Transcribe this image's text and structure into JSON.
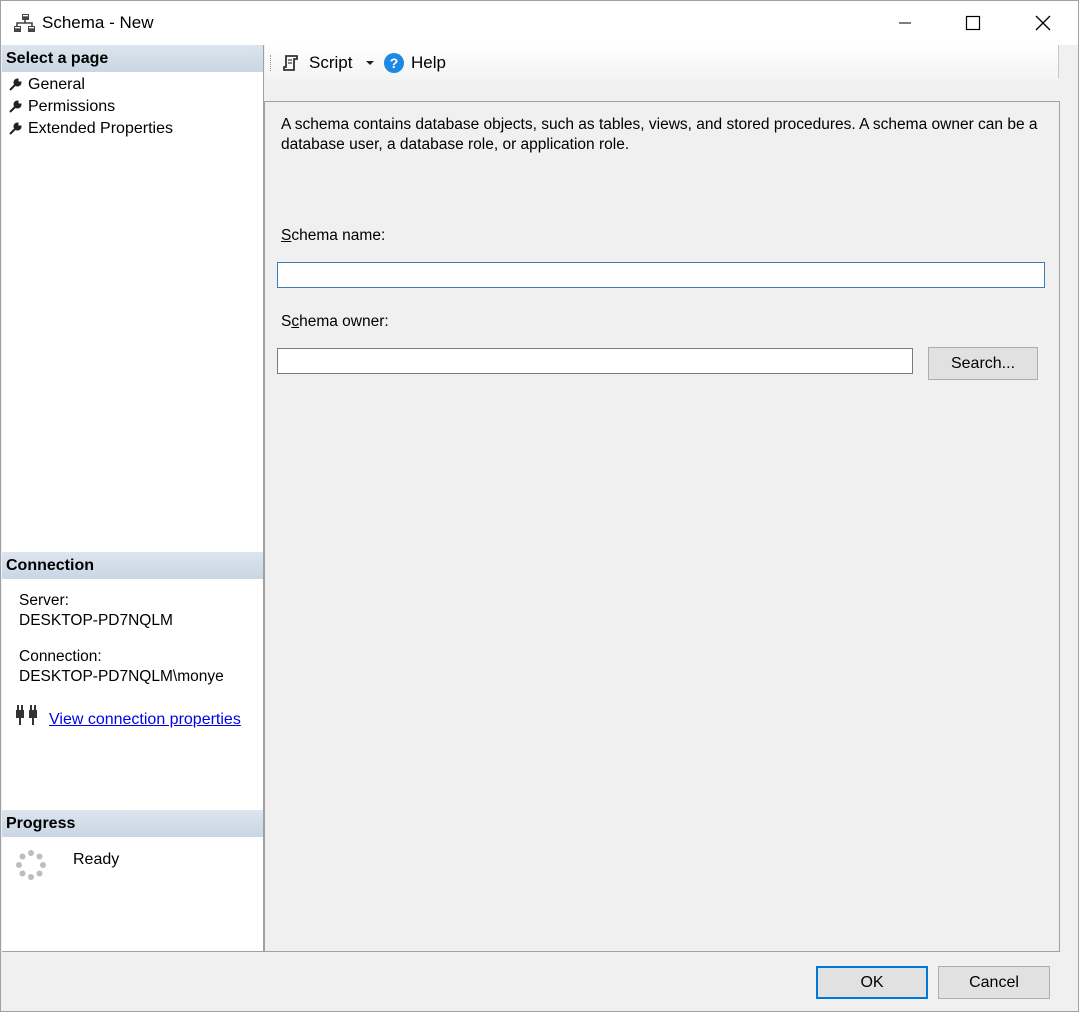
{
  "window": {
    "title": "Schema - New"
  },
  "left_panel": {
    "select_page_header": "Select a page",
    "pages": [
      {
        "label": "General",
        "selected": true
      },
      {
        "label": "Permissions",
        "selected": false
      },
      {
        "label": "Extended Properties",
        "selected": false
      }
    ],
    "connection_header": "Connection",
    "server_label": "Server:",
    "server_value": "DESKTOP-PD7NQLM",
    "connection_label": "Connection:",
    "connection_value": "DESKTOP-PD7NQLM\\monye",
    "view_connection_link": "View connection properties",
    "progress_header": "Progress",
    "progress_status": "Ready"
  },
  "toolbar": {
    "script_label": "Script",
    "help_label": "Help"
  },
  "main": {
    "description": "A schema contains database objects, such as tables, views, and stored procedures. A schema owner can be a database user, a database role, or application role.",
    "schema_name_label_first": "S",
    "schema_name_label_rest": "chema name:",
    "schema_name_value": "",
    "schema_owner_label_first": "S",
    "schema_owner_label_u": "c",
    "schema_owner_label_rest": "hema owner:",
    "schema_owner_value": "",
    "search_button_label": "Search..."
  },
  "footer": {
    "ok_label": "OK",
    "cancel_label": "Cancel"
  },
  "colors": {
    "header_gradient_top": "#dde5ee",
    "header_gradient_bottom": "#c9d6e4",
    "link": "#0000ee",
    "focus_border": "#3d7ab8",
    "default_button_border": "#0078d7",
    "help_icon": "#1e88e5"
  }
}
